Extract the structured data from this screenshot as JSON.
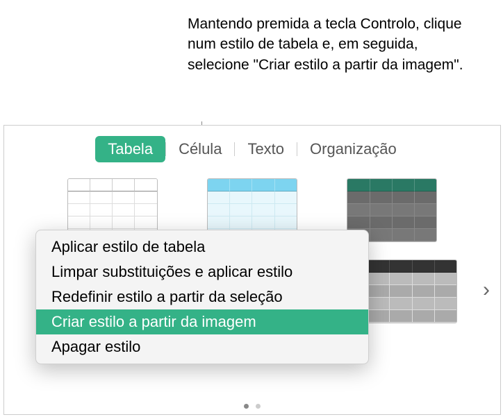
{
  "annotation": "Mantendo premida a tecla Controlo, clique num estilo de tabela e, em seguida, selecione \"Criar estilo a partir da imagem\".",
  "tabs": {
    "tabela": "Tabela",
    "celula": "Célula",
    "texto": "Texto",
    "organizacao": "Organização"
  },
  "menu": {
    "items": [
      "Aplicar estilo de tabela",
      "Limpar substituições e aplicar estilo",
      "Redefinir estilo a partir da seleção",
      "Criar estilo a partir da imagem",
      "Apagar estilo"
    ],
    "highlighted_index": 3
  },
  "style_thumbs": {
    "names": [
      "plain-table",
      "blue-table",
      "teal-dark-table",
      "grey-table"
    ]
  },
  "nav": {
    "chevron": "›"
  },
  "pager": {
    "count": 2,
    "active_index": 0
  }
}
